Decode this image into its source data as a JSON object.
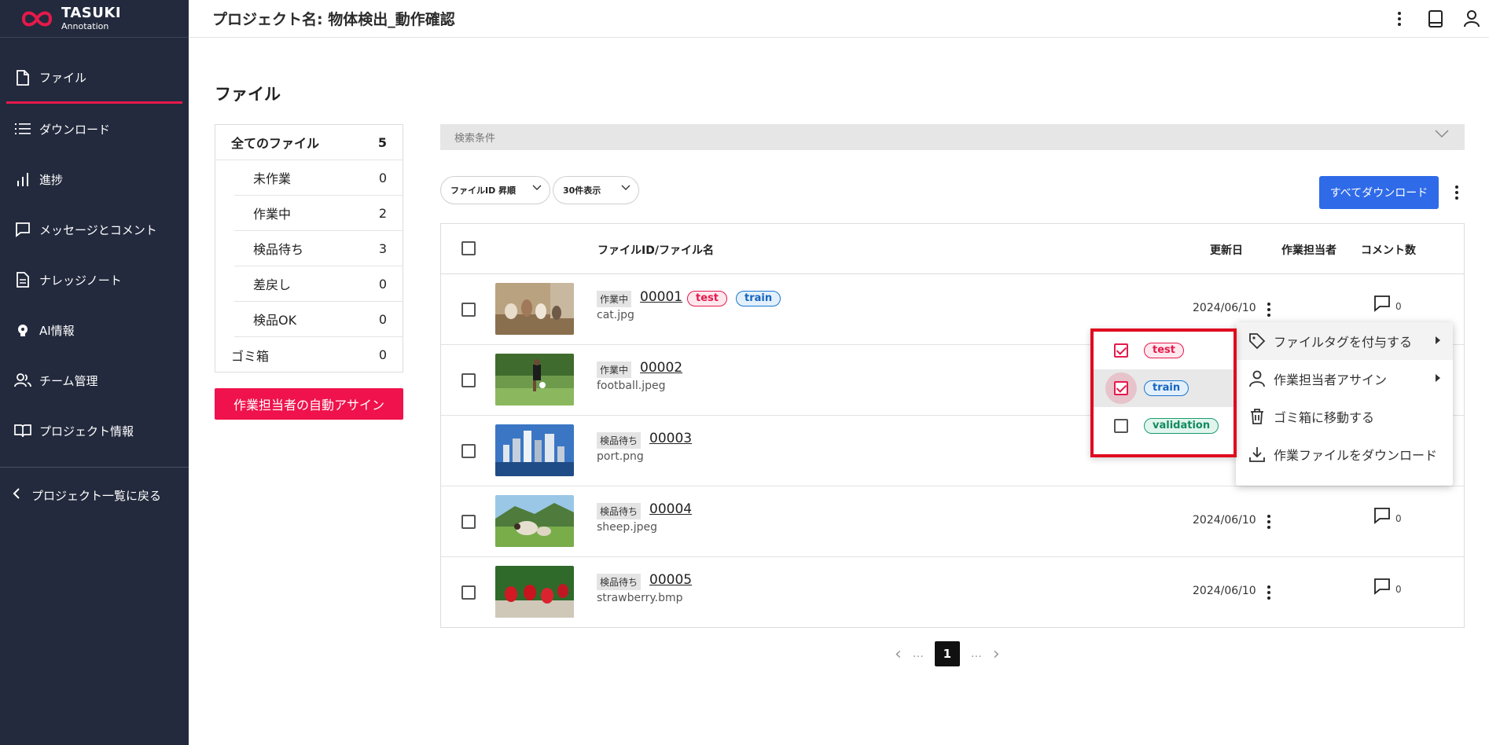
{
  "app": {
    "logo_line1": "TASUKI",
    "logo_line2": "Annotation",
    "accent": "#e6194b"
  },
  "header": {
    "project_title": "プロジェクト名: 物体検出_動作確認"
  },
  "sidebar": {
    "items": [
      {
        "label": "ファイル",
        "icon": "file-icon"
      },
      {
        "label": "ダウンロード",
        "icon": "list-icon"
      },
      {
        "label": "進捗",
        "icon": "bar-chart-icon"
      },
      {
        "label": "メッセージとコメント",
        "icon": "message-icon"
      },
      {
        "label": "ナレッジノート",
        "icon": "document-icon"
      },
      {
        "label": "AI情報",
        "icon": "ai-icon"
      },
      {
        "label": "チーム管理",
        "icon": "team-icon"
      },
      {
        "label": "プロジェクト情報",
        "icon": "book-icon"
      }
    ],
    "back_label": "プロジェクト一覧に戻る"
  },
  "page": {
    "title": "ファイル"
  },
  "status_counts": {
    "all": {
      "label": "全てのファイル",
      "count": "5"
    },
    "sub": [
      {
        "label": "未作業",
        "count": "0"
      },
      {
        "label": "作業中",
        "count": "2"
      },
      {
        "label": "検品待ち",
        "count": "3"
      },
      {
        "label": "差戻し",
        "count": "0"
      },
      {
        "label": "検品OK",
        "count": "0"
      }
    ],
    "trash": {
      "label": "ゴミ箱",
      "count": "0"
    }
  },
  "auto_assign_label": "作業担当者の自動アサイン",
  "search": {
    "label": "検索条件"
  },
  "sort_select": "ファイルID 昇順",
  "perpage_select": "30件表示",
  "download_all_label": "すべてダウンロード",
  "table": {
    "headers": {
      "file": "ファイルID/ファイル名",
      "updated": "更新日",
      "assignee": "作業担当者",
      "comments": "コメント数"
    },
    "rows": [
      {
        "status": "作業中",
        "id": "00001",
        "name": "cat.jpg",
        "tags": [
          "test",
          "train"
        ],
        "date": "2024/06/10",
        "comments": "0"
      },
      {
        "status": "作業中",
        "id": "00002",
        "name": "football.jpeg",
        "tags": [],
        "date": "",
        "comments": ""
      },
      {
        "status": "検品待ち",
        "id": "00003",
        "name": "port.png",
        "tags": [],
        "date": "",
        "comments": ""
      },
      {
        "status": "検品待ち",
        "id": "00004",
        "name": "sheep.jpeg",
        "tags": [],
        "date": "2024/06/10",
        "comments": "0"
      },
      {
        "status": "検品待ち",
        "id": "00005",
        "name": "strawberry.bmp",
        "tags": [],
        "date": "2024/06/10",
        "comments": "0"
      }
    ]
  },
  "pagination": {
    "prev": "‹",
    "ellipsis": "…",
    "current": "1",
    "next": "›"
  },
  "context_menu": {
    "items": [
      {
        "label": "ファイルタグを付与する",
        "icon": "tag-icon"
      },
      {
        "label": "作業担当者アサイン",
        "icon": "person-icon"
      },
      {
        "label": "ゴミ箱に移動する",
        "icon": "trash-icon"
      },
      {
        "label": "作業ファイルをダウンロード",
        "icon": "download-icon"
      }
    ]
  },
  "tag_menu": {
    "items": [
      {
        "label": "test",
        "checked": true
      },
      {
        "label": "train",
        "checked": true
      },
      {
        "label": "validation",
        "checked": false
      }
    ]
  }
}
